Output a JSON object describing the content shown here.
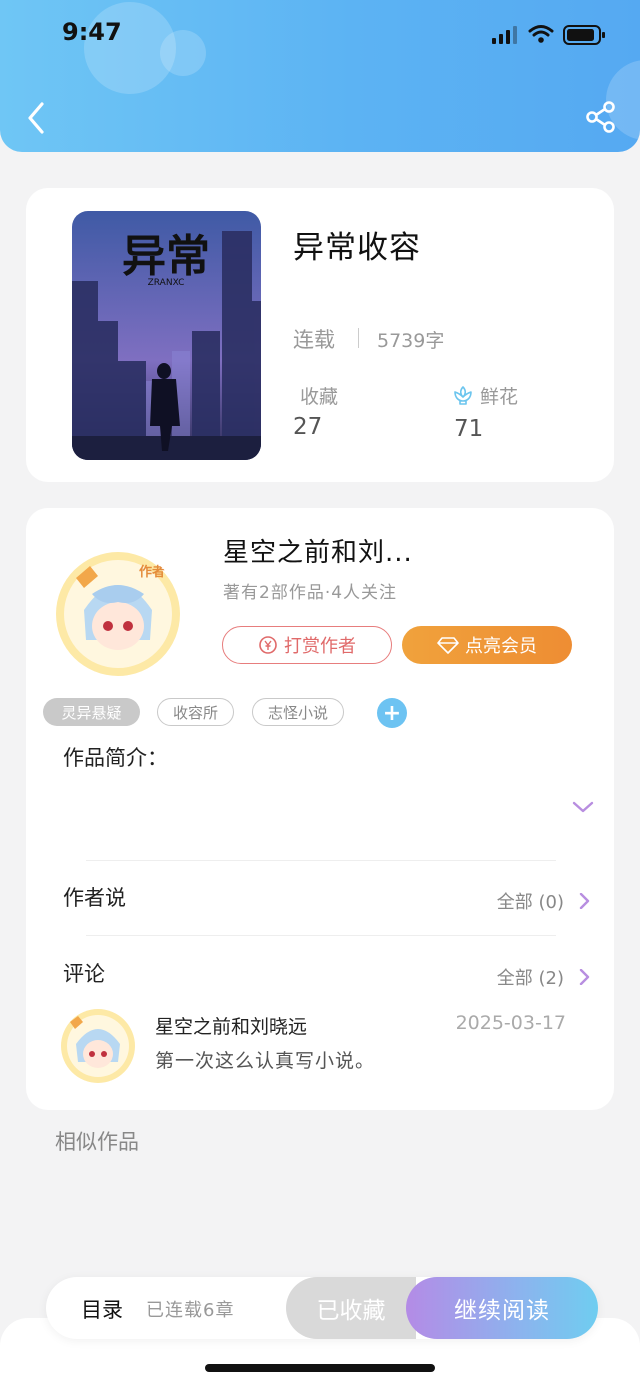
{
  "status_bar": {
    "time": "9:47"
  },
  "book": {
    "title": "异常收容",
    "status": "连载",
    "word_count": "5739字",
    "favorites_label": "收藏",
    "favorites_value": "27",
    "flowers_label": "鲜花",
    "flowers_value": "71",
    "cover_text": "异常",
    "cover_subtext": "ZRANXC"
  },
  "author": {
    "name": "星空之前和刘...",
    "meta": "著有2部作品·4人关注",
    "tip_label": "打赏作者",
    "vip_label": "点亮会员",
    "badge": "作者"
  },
  "tags": [
    "灵异悬疑",
    "收容所",
    "志怪小说"
  ],
  "intro": {
    "label": "作品简介："
  },
  "author_says": {
    "label": "作者说",
    "all": "全部 (0)"
  },
  "comments": {
    "label": "评论",
    "all": "全部 (2)",
    "items": [
      {
        "user": "星空之前和刘晓远",
        "date": "2025-03-17",
        "text": "第一次这么认真写小说。"
      }
    ]
  },
  "similar": {
    "label": "相似作品"
  },
  "bottom": {
    "toc_label": "目录",
    "toc_count": "已连载6章",
    "collected_label": "已收藏",
    "read_label": "继续阅读"
  },
  "colors": {
    "header_start": "#6fc6f5",
    "header_end": "#55a9f2",
    "accent_orange": "#ee8d33",
    "accent_red": "#e06a6a",
    "accent_purple": "#b48be6",
    "tag_add": "#6dc3f2"
  }
}
